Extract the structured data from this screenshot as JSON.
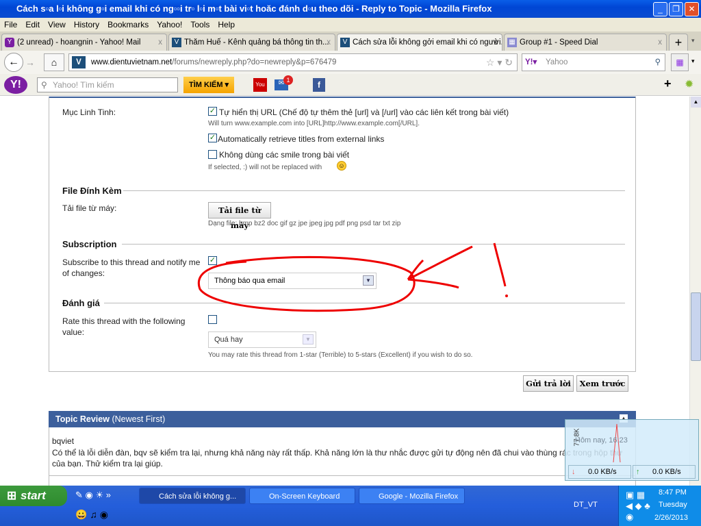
{
  "window": {
    "title": "Cách s▫a l▫i không g▫i email khi có ng▫▫i tr▫ l▫i m▫t bài vi▫t hoăc đánh d▫u theo dõi - Reply to Topic - Mozilla Firefox",
    "minimize": "_",
    "restore": "❐",
    "close": "✕"
  },
  "menu": [
    "File",
    "Edit",
    "View",
    "History",
    "Bookmarks",
    "Yahoo!",
    "Tools",
    "Help"
  ],
  "tabs": [
    {
      "label": "(2 unread) - hoangnin - Yahoo! Mail"
    },
    {
      "label": "Thăm Huế - Kênh quảng bá thông tin th..."
    },
    {
      "label": "Cách sửa lỗi không gởi email khi có người..."
    },
    {
      "label": "Group #1 - Speed Dial"
    }
  ],
  "nav": {
    "url_domain": "www.dientuvietnam.net",
    "url_path": "/forums/newreply.php?do=newreply&p=676479",
    "search_placeholder": "Yahoo"
  },
  "yahoo_toolbar": {
    "search_placeholder": "Yahoo! Tìm kiếm",
    "search_button": "TÌM KIẾM",
    "mail_badge": "1"
  },
  "form": {
    "misc_label": "Mục Linh Tinh:",
    "opt_url": "Tự hiển thị URL (Chế độ tự thêm thẻ [url] và [/url] vào các liên kết trong bài viết)",
    "opt_url_hint": "Will turn www.example.com into [URL]http://www.example.com[/URL].",
    "opt_titles": "Automatically retrieve titles from external links",
    "opt_smile": "Không dùng các smile trong bài viết",
    "opt_smile_hint": "If selected, :) will not be replaced with",
    "attach_title": "File Đính Kèm",
    "attach_label": "Tải file từ máy:",
    "attach_button": "Tải file từ máy",
    "attach_hint": "Dạng file: bmp bz2 doc gif gz jpe jpeg jpg pdf png psd tar txt zip",
    "sub_title": "Subscription",
    "sub_label": "Subscribe to this thread and notify me of changes:",
    "sub_select": "Thông báo qua email",
    "rate_title": "Đánh giá",
    "rate_label": "Rate this thread with the following value:",
    "rate_select": "Quá hay",
    "rate_hint": "You may rate this thread from 1-star (Terrible) to 5-stars (Excellent) if you wish to do so.",
    "submit": "Gửi trả lời",
    "preview": "Xem trước"
  },
  "review": {
    "title": "Topic Review",
    "subtitle": "(Newest First)",
    "author": "bqviet",
    "text": "Có thể là lỗi diễn đàn, bqv sẽ kiểm tra lại, nhưng khả năng này rất thấp. Khả năng lớn là thư nhắc được gửi tự động nên đã chui vào thùng rác trong hộp thư của bạn. Thử kiểm tra lại giúp.",
    "date": "Hôm nay, 16:23"
  },
  "netmon": {
    "scale": "77.8K",
    "down": "0.0 KB/s",
    "up": "0.0 KB/s"
  },
  "taskbar": {
    "start": "start",
    "tasks": [
      "Cách sửa lỗi không g...",
      "On-Screen Keyboard",
      "Google - Mozilla Firefox"
    ],
    "user": "DT_VT",
    "time": "8:47 PM",
    "day": "Tuesday",
    "date": "2/26/2013"
  }
}
